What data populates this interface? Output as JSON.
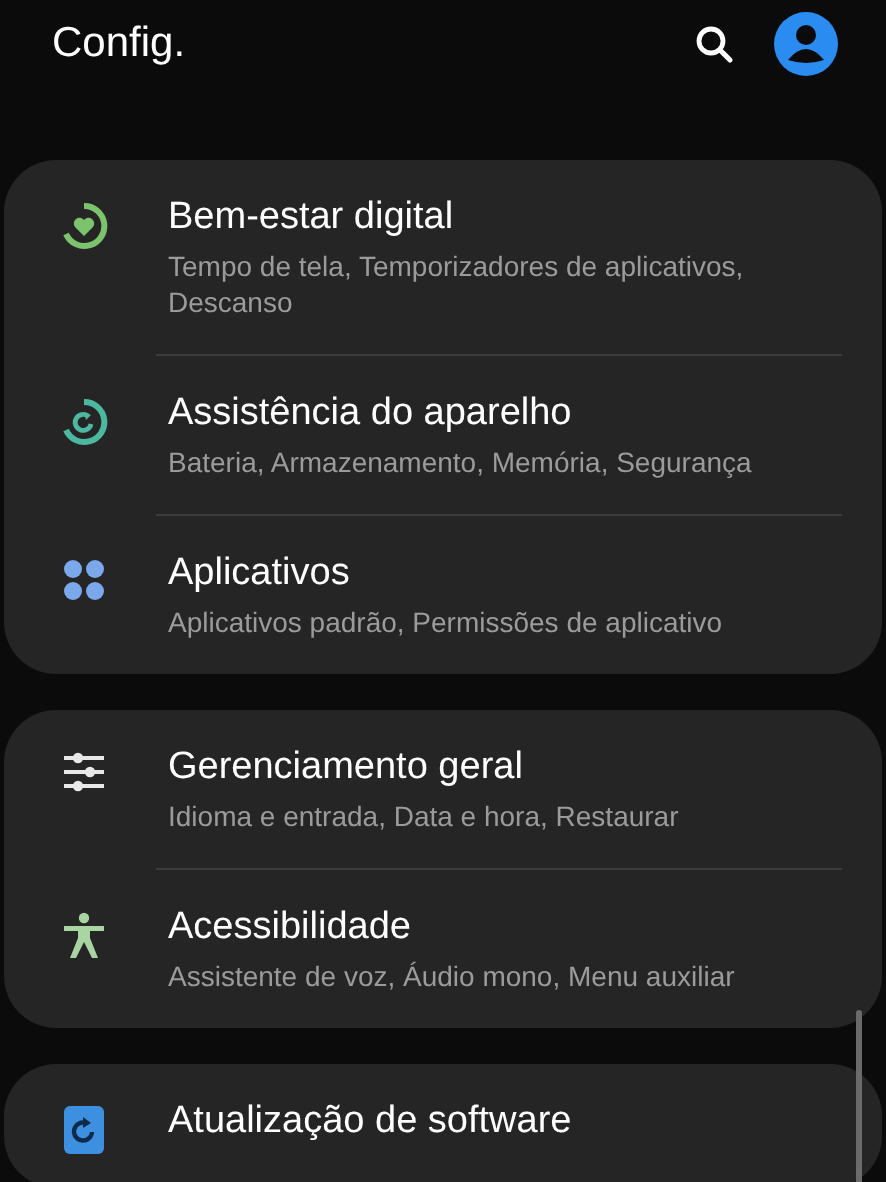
{
  "header": {
    "title": "Config."
  },
  "groups": [
    {
      "items": [
        {
          "kind": "wellbeing",
          "title": "Bem-estar digital",
          "subtitle": "Tempo de tela, Temporizadores de aplicativos, Descanso"
        },
        {
          "kind": "care",
          "title": "Assistência do aparelho",
          "subtitle": "Bateria, Armazenamento, Memória, Segurança"
        },
        {
          "kind": "apps",
          "title": "Aplicativos",
          "subtitle": "Aplicativos padrão, Permissões de aplicativo"
        }
      ]
    },
    {
      "items": [
        {
          "kind": "general",
          "title": "Gerenciamento geral",
          "subtitle": "Idioma e entrada, Data e hora, Restaurar"
        },
        {
          "kind": "accessibility",
          "title": "Acessibilidade",
          "subtitle": "Assistente de voz, Áudio mono, Menu auxiliar"
        }
      ]
    },
    {
      "items": [
        {
          "kind": "update",
          "title": "Atualização de software"
        }
      ]
    }
  ]
}
